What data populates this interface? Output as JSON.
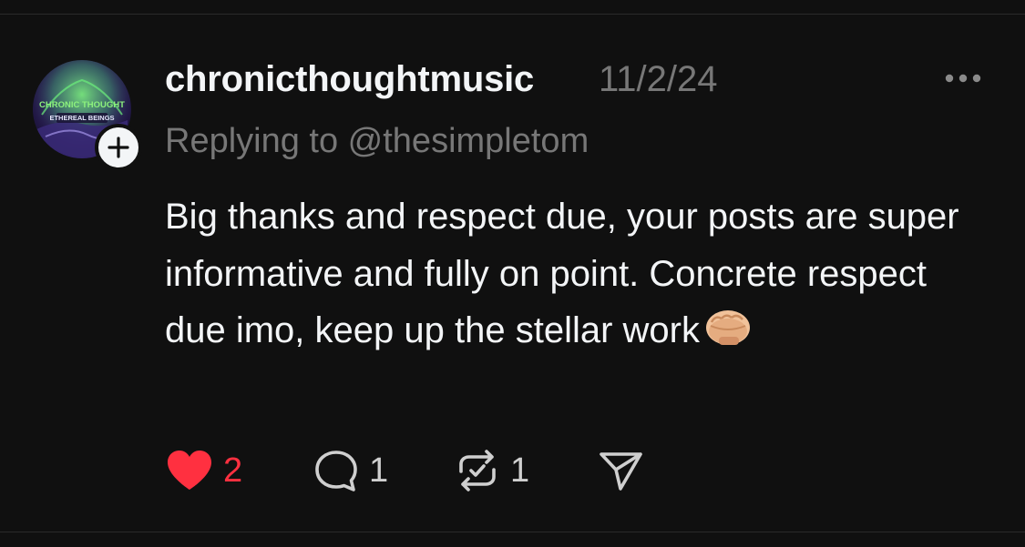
{
  "post": {
    "username": "chronicthoughtmusic",
    "timestamp": "11/2/24",
    "replying_to": "Replying to @thesimpletom",
    "text": "Big thanks and respect due, your posts are super informative and fully on point. Concrete respect due imo, keep up the stellar work",
    "emoji": "oncoming-fist-emoji",
    "avatar_text": {
      "line1": "CHRONIC THOUGHT",
      "line2": "ETHEREAL BEINGS"
    }
  },
  "actions": {
    "like": {
      "icon": "heart-icon",
      "count": "2",
      "active": true,
      "color": "#ff3040"
    },
    "reply": {
      "icon": "reply-bubble-icon",
      "count": "1"
    },
    "repost": {
      "icon": "repost-icon",
      "count": "1"
    },
    "share": {
      "icon": "send-icon"
    }
  },
  "menu": {
    "icon": "more-options-icon"
  },
  "colors": {
    "background": "#101010",
    "primary_text": "#f3f5f7",
    "secondary_text": "#777777",
    "like": "#ff3040"
  }
}
